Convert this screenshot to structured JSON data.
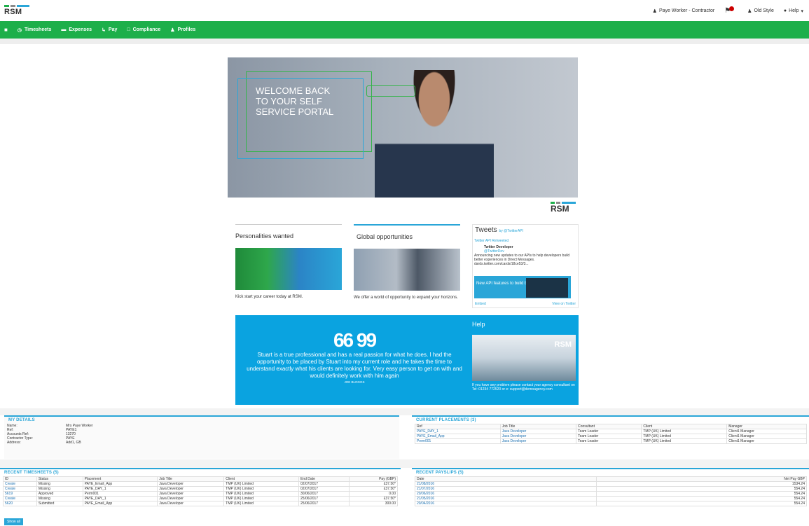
{
  "brand": {
    "logo_text": "RSM",
    "colors": {
      "green": "#1daf4a",
      "blue": "#2aa6d8",
      "grey": "#8a8a8a"
    }
  },
  "topbar": {
    "user": "Paye Worker - Contractor",
    "old_style": "Old Style",
    "help": "Help"
  },
  "nav": [
    {
      "label": "Timesheets",
      "icon": "clock-icon"
    },
    {
      "label": "Expenses",
      "icon": "card-icon"
    },
    {
      "label": "Pay",
      "icon": "pay-icon"
    },
    {
      "label": "Compliance",
      "icon": "document-icon"
    },
    {
      "label": "Profiles",
      "icon": "user-icon"
    }
  ],
  "hero": {
    "welcome": "WELCOME BACK\nTO YOUR SELF\nSERVICE PORTAL"
  },
  "cards": {
    "personalities": {
      "title": "Personalities wanted",
      "caption": "Kick start your career today at RSM."
    },
    "global": {
      "title": "Global opportunities",
      "caption": "We offer a world of opportunity to expand your horizons."
    }
  },
  "tweets": {
    "title": "Tweets",
    "by": "by @TwitterAPI",
    "retweeted": "Twitter API Retweeted",
    "author": "Twitter Developer",
    "handle": "@TwitterDev",
    "text": "Announcing new updates to our APIs to help developers build better experiences in Direct Messages. dards.twitter.com/cards/18ce53/3...",
    "image_text": "New API features to build better",
    "embed": "Embed",
    "view": "View on Twitter"
  },
  "quote": {
    "mark": "66 99",
    "text": "Stuart is a true professional and has a real passion for what he does. I had the opportunity to be placed by Stuart into my current role and he takes the time to understand exactly what his clients are looking for. Very easy person to get on with and would definitely work with him again",
    "by": "JOE BLOGGS"
  },
  "help": {
    "title": "Help",
    "logo": "RSM",
    "text": "If you have any problem please contact your agency consultant on\nTel: 01234 772520 or e: support@demoagency.com"
  },
  "my_details": {
    "title": "MY DETAILS",
    "rows": [
      [
        "Name:",
        "Mrs Paye Worker"
      ],
      [
        "Ref:",
        "PAYE1"
      ],
      [
        "Accounts Ref:",
        "13270"
      ],
      [
        "Contractor Type:",
        "PAYE"
      ],
      [
        "Address:",
        "Add1, GB"
      ]
    ]
  },
  "current_placements": {
    "title": "CURRENT PLACEMENTS (3)",
    "headers": [
      "Ref",
      "Job Title",
      "Consultant",
      "Client",
      "Manager"
    ],
    "rows": [
      [
        "PAYE_DAY_1",
        "Java Developer",
        "Team Leader",
        "TMP (UK) Limited",
        "Client1 Manager"
      ],
      [
        "PAYE_Email_App",
        "Java Developer",
        "Team Leader",
        "TMP (UK) Limited",
        "Client1 Manager"
      ],
      [
        "Perm001",
        "Java Developer",
        "Team Leader",
        "TMP (UK) Limited",
        "Client1 Manager"
      ]
    ]
  },
  "recent_timesheets": {
    "title": "RECENT TIMESHEETS (5)",
    "headers": [
      "ID",
      "Status",
      "Placement",
      "Job Title",
      "Client",
      "End Date",
      "Pay (GBP)"
    ],
    "rows": [
      [
        "Create",
        "Missing",
        "PAYE_Email_App",
        "Java Developer",
        "TMP (UK) Limited",
        "02/07/2017",
        "£37.50*"
      ],
      [
        "Create",
        "Missing",
        "PAYE_DAY_1",
        "Java Developer",
        "TMP (UK) Limited",
        "02/07/2017",
        "£37.50*"
      ],
      [
        "5619",
        "Approved",
        "Perm001",
        "Java Developer",
        "TMP (UK) Limited",
        "30/06/2017",
        "0.00"
      ],
      [
        "Create",
        "Missing",
        "PAYE_DAY_1",
        "Java Developer",
        "TMP (UK) Limited",
        "25/06/2017",
        "£37.50*"
      ],
      [
        "5620",
        "Submitted",
        "PAYE_Email_App",
        "Java Developer",
        "TMP (UK) Limited",
        "25/06/2017",
        "300.00"
      ]
    ],
    "show_all": "Show all"
  },
  "recent_payslips": {
    "title": "RECENT PAYSLIPS (5)",
    "headers": [
      "Date",
      "Net Pay GBP"
    ],
    "rows": [
      [
        "21/08/2016",
        "1534.24"
      ],
      [
        "21/07/2016",
        "554.24"
      ],
      [
        "20/06/2016",
        "554.24"
      ],
      [
        "21/05/2016",
        "554.24"
      ],
      [
        "20/04/2016",
        "554.24"
      ]
    ]
  }
}
